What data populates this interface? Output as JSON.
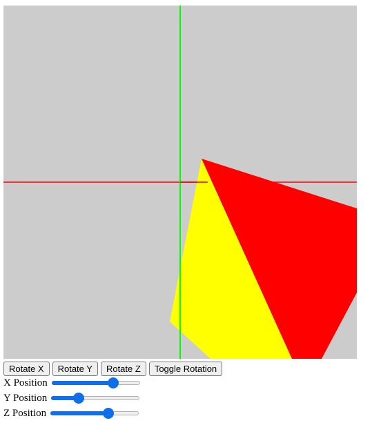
{
  "colors": {
    "background": "#cccccc",
    "x_axis": "#ff0000",
    "y_axis": "#00ff00",
    "face_yellow": "#ffff00",
    "face_red": "#ff0000",
    "slider_accent": "#0f6fe8"
  },
  "controls": {
    "rotate_x": "Rotate X",
    "rotate_y": "Rotate Y",
    "rotate_z": "Rotate Z",
    "toggle_rotation": "Toggle Rotation"
  },
  "sliders": [
    {
      "label": "X Position",
      "value_fraction": 0.73
    },
    {
      "label": "Y Position",
      "value_fraction": 0.28
    },
    {
      "label": "Z Position",
      "value_fraction": 0.68
    }
  ]
}
